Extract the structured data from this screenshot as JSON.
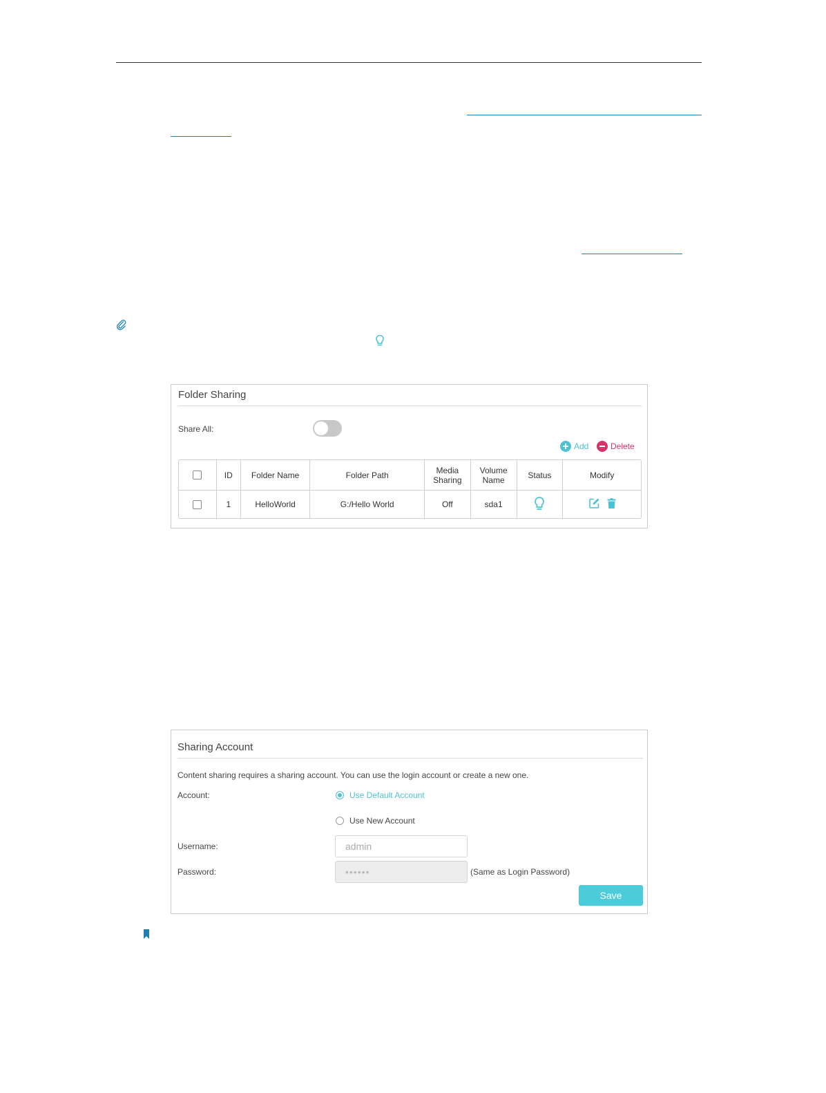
{
  "folder_sharing": {
    "title": "Folder Sharing",
    "share_all_label": "Share All:",
    "share_all_on": false,
    "add_label": "Add",
    "delete_label": "Delete",
    "columns": [
      "ID",
      "Folder Name",
      "Folder Path",
      "Media Sharing",
      "Volume Name",
      "Status",
      "Modify"
    ],
    "columns_multiline": {
      "media_1": "Media",
      "media_2": "Sharing",
      "volume_1": "Volume",
      "volume_2": "Name"
    },
    "rows": [
      {
        "id": "1",
        "folder_name": "HelloWorld",
        "folder_path": "G:/Hello World",
        "media_sharing": "Off",
        "volume_name": "sda1",
        "status_icon": "lightbulb-icon",
        "modify_icons": [
          "edit-icon",
          "trash-icon"
        ]
      }
    ]
  },
  "sharing_account": {
    "title": "Sharing Account",
    "description": "Content sharing requires a sharing account. You can use the login account or create a new one.",
    "account_label": "Account:",
    "option_default": "Use Default Account",
    "option_new": "Use New Account",
    "selected": "default",
    "username_label": "Username:",
    "username_value": "admin",
    "password_label": "Password:",
    "password_value": "••••••",
    "password_hint": "(Same as Login Password)",
    "save_label": "Save"
  },
  "icons": {
    "note": "paperclip-icon",
    "tip": "lightbulb-icon",
    "bookmark": "bookmark-icon"
  },
  "colors": {
    "accent": "#4cc3d4",
    "delete": "#d6336c",
    "link": "#1d7fb3"
  }
}
